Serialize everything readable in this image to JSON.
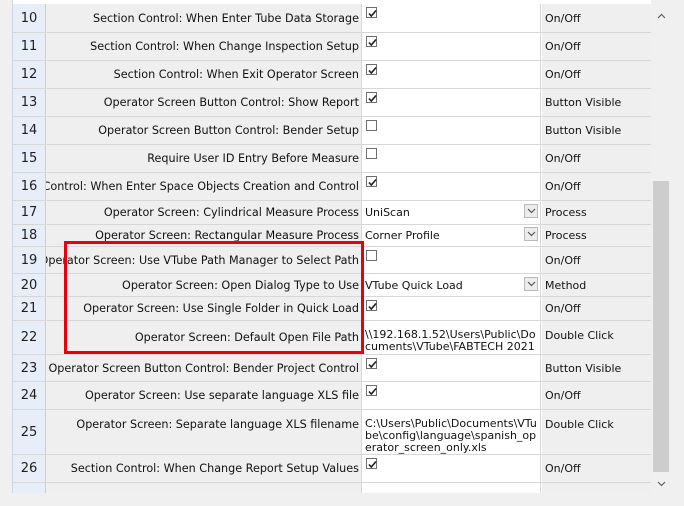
{
  "rows": [
    {
      "num": "10",
      "label": "Section Control: When Enter Tube Data Storage",
      "value_kind": "checkbox",
      "checked": true,
      "type": "On/Off"
    },
    {
      "num": "11",
      "label": "Section Control: When Change Inspection Setup",
      "value_kind": "checkbox",
      "checked": true,
      "type": "On/Off"
    },
    {
      "num": "12",
      "label": "Section Control: When Exit Operator Screen",
      "value_kind": "checkbox",
      "checked": true,
      "type": "On/Off"
    },
    {
      "num": "13",
      "label": "Operator Screen Button Control: Show Report",
      "value_kind": "checkbox",
      "checked": true,
      "type": "Button Visible"
    },
    {
      "num": "14",
      "label": "Operator Screen Button Control: Bender Setup",
      "value_kind": "checkbox",
      "checked": false,
      "type": "Button Visible"
    },
    {
      "num": "15",
      "label": "Require User ID Entry Before Measure",
      "value_kind": "checkbox",
      "checked": false,
      "type": "On/Off"
    },
    {
      "num": "16",
      "label": "Section Control: When Enter Space Objects Creation and Control",
      "value_kind": "checkbox",
      "checked": true,
      "type": "On/Off"
    },
    {
      "num": "17",
      "label": "Operator Screen: Cylindrical Measure Process",
      "value_kind": "dropdown",
      "value": "UniScan",
      "type": "Process"
    },
    {
      "num": "18",
      "label": "Operator Screen: Rectangular Measure Process",
      "value_kind": "dropdown",
      "value": "Corner Profile",
      "type": "Process"
    },
    {
      "num": "19",
      "label": "Operator Screen: Use VTube Path Manager to Select Path",
      "value_kind": "checkbox",
      "checked": false,
      "type": "On/Off"
    },
    {
      "num": "20",
      "label": "Operator Screen: Open Dialog Type to Use",
      "value_kind": "dropdown",
      "value": "VTube Quick Load",
      "type": "Method"
    },
    {
      "num": "21",
      "label": "Operator Screen: Use Single Folder in Quick Load",
      "value_kind": "checkbox",
      "checked": true,
      "type": "On/Off"
    },
    {
      "num": "22",
      "label": "Operator Screen: Default Open File Path",
      "value_kind": "text",
      "value": "\\\\192.168.1.52\\Users\\Public\\Documents\\VTube\\FABTECH 2021",
      "type": "Double Click"
    },
    {
      "num": "23",
      "label": "Operator Screen Button Control: Bender Project Control",
      "value_kind": "checkbox",
      "checked": true,
      "type": "Button Visible"
    },
    {
      "num": "24",
      "label": "Operator Screen: Use separate language XLS file",
      "value_kind": "checkbox",
      "checked": true,
      "type": "On/Off"
    },
    {
      "num": "25",
      "label": "Operator Screen: Separate language XLS filename",
      "value_kind": "text",
      "value": "C:\\Users\\Public\\Documents\\VTube\\config\\language\\spanish_operator_screen_only.xls",
      "type": "Double Click"
    },
    {
      "num": "26",
      "label": "Section Control: When Change Report Setup Values",
      "value_kind": "checkbox",
      "checked": true,
      "type": "On/Off"
    }
  ],
  "icons": {
    "scroll_up": "chevron-up-icon",
    "scroll_down": "chevron-down-icon",
    "dropdown": "chevron-down-icon",
    "check": "checkmark-icon"
  },
  "colors": {
    "highlight_box": "#e8000e",
    "row_header_bg": "#e7eef8",
    "label_bg": "#efefef"
  }
}
